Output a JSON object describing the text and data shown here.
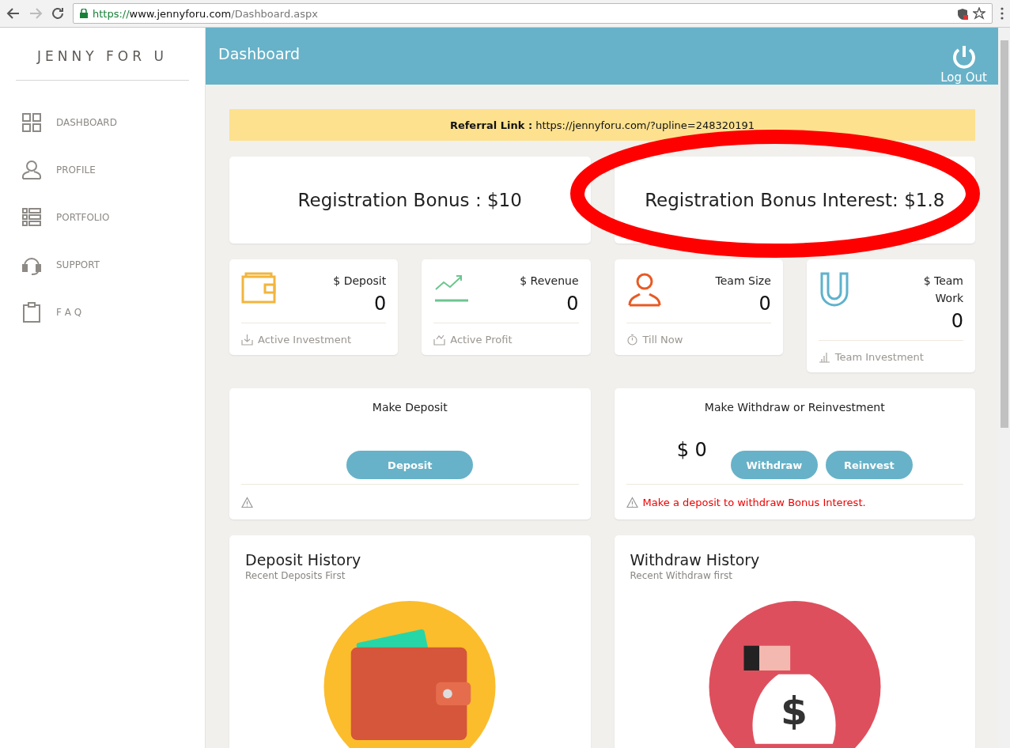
{
  "browser": {
    "url_scheme": "https://",
    "url_host": "www.jennyforu.com",
    "url_path": "/Dashboard.aspx"
  },
  "sidebar": {
    "brand": "JENNY FOR U",
    "items": [
      {
        "label": "DASHBOARD",
        "kind": "grid"
      },
      {
        "label": "PROFILE",
        "kind": "person"
      },
      {
        "label": "PORTFOLIO",
        "kind": "list"
      },
      {
        "label": "SUPPORT",
        "kind": "headset"
      },
      {
        "label": "F A Q",
        "kind": "clipboard"
      }
    ]
  },
  "header": {
    "title": "Dashboard",
    "logout": "Log Out"
  },
  "referral": {
    "label": "Referral Link :",
    "link": "https://jennyforu.com/?upline=248320191"
  },
  "bonus_cards": [
    "Registration Bonus : $10",
    "Registration Bonus Interest: $1.8"
  ],
  "annotation": {
    "kind": "ellipse"
  },
  "stats": [
    {
      "kind": "wallet",
      "title": "$ Deposit",
      "value": "0",
      "footer": "Active Investment"
    },
    {
      "kind": "trend",
      "title": "$ Revenue",
      "value": "0",
      "footer": "Active Profit"
    },
    {
      "kind": "person",
      "title": "Team Size",
      "value": "0",
      "footer": "Till Now"
    },
    {
      "kind": "magnet",
      "title": "$ Team Work",
      "value": "0",
      "footer": "Team Investment"
    }
  ],
  "deposit_panel": {
    "title": "Make Deposit",
    "button": "Deposit"
  },
  "withdraw_panel": {
    "title": "Make Withdraw or Reinvestment",
    "amount": "$ 0",
    "buttons": [
      "Withdraw",
      "Reinvest"
    ],
    "notice": "Make a deposit to withdraw Bonus Interest."
  },
  "history": [
    {
      "kind": "wallet",
      "title": "Deposit History",
      "subtitle": "Recent Deposits First"
    },
    {
      "kind": "moneybag",
      "title": "Withdraw History",
      "subtitle": "Recent Withdraw first",
      "symbol": "$"
    }
  ]
}
